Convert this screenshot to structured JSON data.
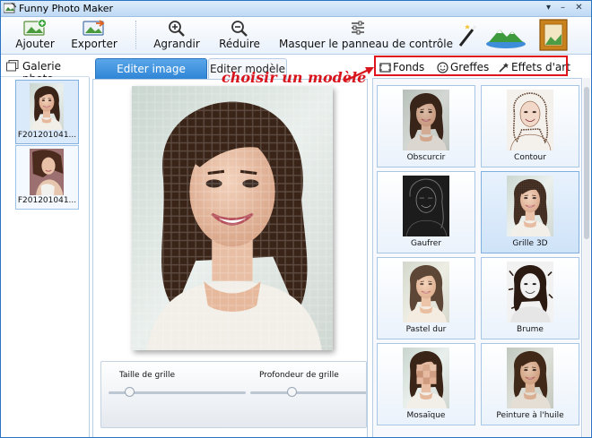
{
  "window": {
    "title": "Funny Photo Maker"
  },
  "toolbar": {
    "add_label": "Ajouter",
    "export_label": "Exporter",
    "zoom_in_label": "Agrandir",
    "zoom_out_label": "Réduire",
    "hide_panel_label": "Masquer le panneau de contrôle"
  },
  "gallery": {
    "title": "Galerie photo",
    "items": [
      {
        "caption": "F201201041...",
        "selected": true
      },
      {
        "caption": "F201201041...",
        "selected": false
      }
    ]
  },
  "editor": {
    "tabs": [
      {
        "label": "Editer image d'origine",
        "active": true
      },
      {
        "label": "Editer modèle",
        "active": false
      }
    ],
    "sliders": [
      {
        "label": "Taille de grille",
        "value": 0.15
      },
      {
        "label": "Profondeur de grille",
        "value": 0.35
      }
    ]
  },
  "templates": {
    "tabs": [
      {
        "label": "Fonds",
        "icon": "frame-icon"
      },
      {
        "label": "Greffes",
        "icon": "smiley-icon"
      },
      {
        "label": "Effets d'art",
        "icon": "wand-icon"
      }
    ],
    "annotation": "choisir un modèle",
    "effects": [
      {
        "label": "Obscurcir",
        "selected": false
      },
      {
        "label": "Contour",
        "selected": false
      },
      {
        "label": "Gaufrer",
        "selected": false
      },
      {
        "label": "Grille 3D",
        "selected": true
      },
      {
        "label": "Pastel dur",
        "selected": false
      },
      {
        "label": "Brume",
        "selected": false
      },
      {
        "label": "Mosaïque",
        "selected": false
      },
      {
        "label": "Peinture à l'huile",
        "selected": false
      }
    ]
  },
  "colors": {
    "accent": "#2f86d6",
    "annotation": "#d8141c",
    "border": "#b6cde6"
  }
}
